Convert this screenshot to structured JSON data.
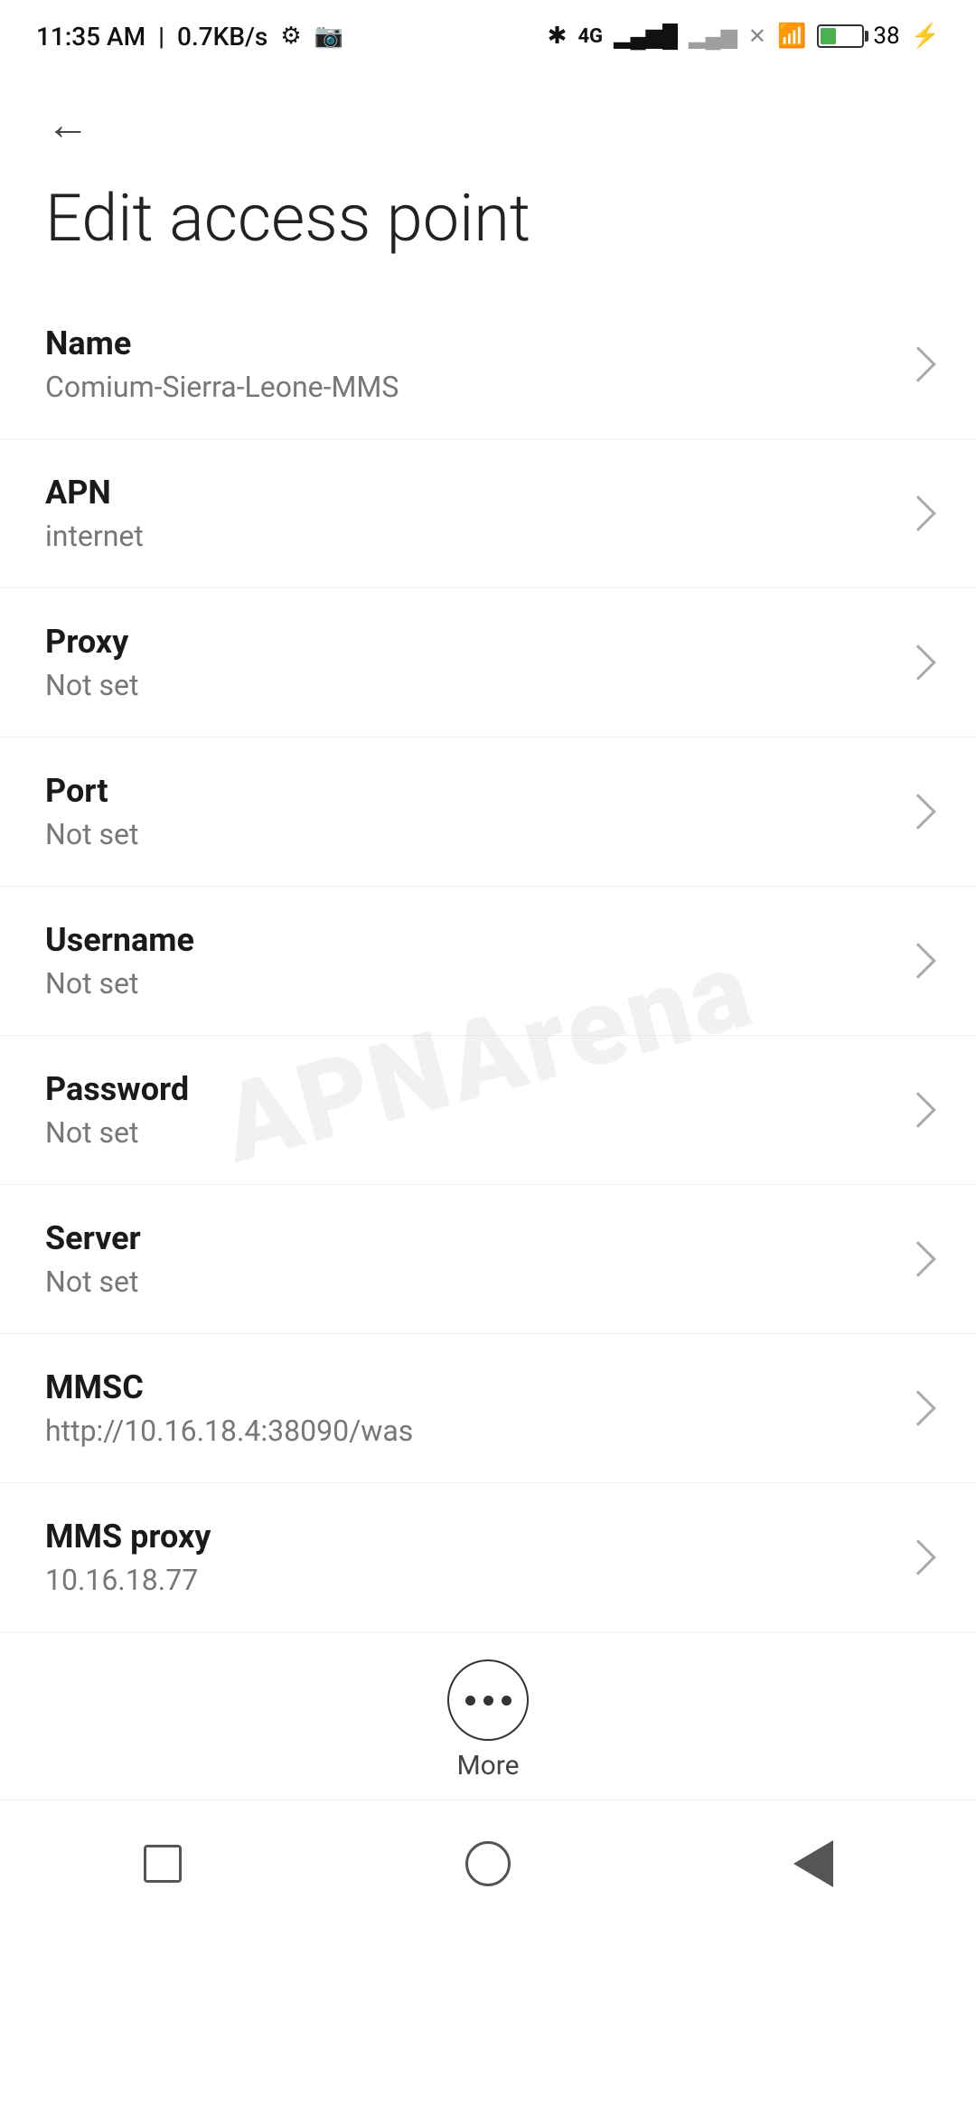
{
  "statusBar": {
    "time": "11:35 AM",
    "speed": "0.7KB/s",
    "batteryPercent": "38"
  },
  "header": {
    "backLabel": "←",
    "title": "Edit access point"
  },
  "settings": {
    "items": [
      {
        "label": "Name",
        "value": "Comium-Sierra-Leone-MMS"
      },
      {
        "label": "APN",
        "value": "internet"
      },
      {
        "label": "Proxy",
        "value": "Not set"
      },
      {
        "label": "Port",
        "value": "Not set"
      },
      {
        "label": "Username",
        "value": "Not set"
      },
      {
        "label": "Password",
        "value": "Not set"
      },
      {
        "label": "Server",
        "value": "Not set"
      },
      {
        "label": "MMSC",
        "value": "http://10.16.18.4:38090/was"
      },
      {
        "label": "MMS proxy",
        "value": "10.16.18.77"
      }
    ]
  },
  "more": {
    "label": "More"
  },
  "watermark": "APNArena"
}
